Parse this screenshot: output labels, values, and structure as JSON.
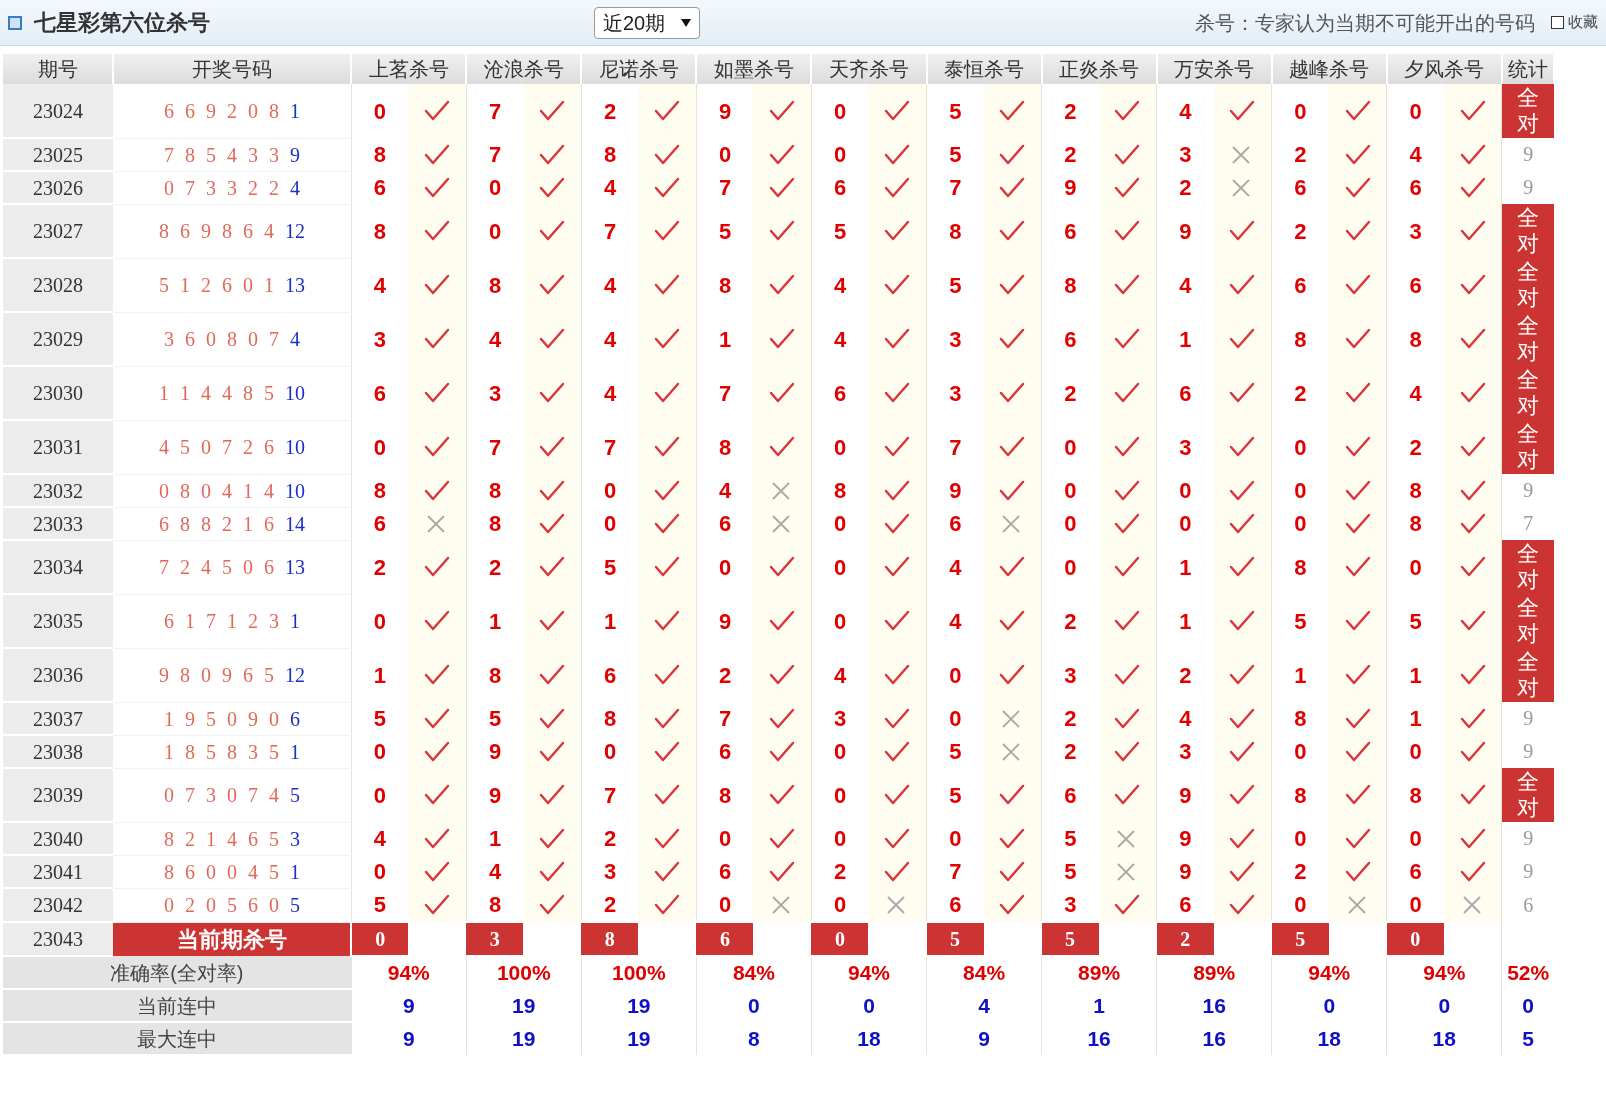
{
  "header": {
    "title": "七星彩第六位杀号",
    "period_select": "近20期",
    "note": "杀号：专家认为当期不可能开出的号码",
    "favorite": {
      "label": "收藏",
      "checked": false
    }
  },
  "table": {
    "columns": [
      "期号",
      "开奖号码",
      "上茗杀号",
      "沧浪杀号",
      "尼诺杀号",
      "如墨杀号",
      "天齐杀号",
      "泰恒杀号",
      "正炎杀号",
      "万安杀号",
      "越峰杀号",
      "夕风杀号",
      "统计"
    ],
    "rows": [
      {
        "period": "23024",
        "numbers": "6 6 9 2 0 8",
        "special": "1",
        "kills": [
          {
            "n": "0",
            "ok": true
          },
          {
            "n": "7",
            "ok": true
          },
          {
            "n": "2",
            "ok": true
          },
          {
            "n": "9",
            "ok": true
          },
          {
            "n": "0",
            "ok": true
          },
          {
            "n": "5",
            "ok": true
          },
          {
            "n": "2",
            "ok": true
          },
          {
            "n": "4",
            "ok": true
          },
          {
            "n": "0",
            "ok": true
          },
          {
            "n": "0",
            "ok": true
          }
        ],
        "stat": "全对",
        "all_correct": true
      },
      {
        "period": "23025",
        "numbers": "7 8 5 4 3 3",
        "special": "9",
        "kills": [
          {
            "n": "8",
            "ok": true
          },
          {
            "n": "7",
            "ok": true
          },
          {
            "n": "8",
            "ok": true
          },
          {
            "n": "0",
            "ok": true
          },
          {
            "n": "0",
            "ok": true
          },
          {
            "n": "5",
            "ok": true
          },
          {
            "n": "2",
            "ok": true
          },
          {
            "n": "3",
            "ok": false
          },
          {
            "n": "2",
            "ok": true
          },
          {
            "n": "4",
            "ok": true
          }
        ],
        "stat": "9",
        "all_correct": false
      },
      {
        "period": "23026",
        "numbers": "0 7 3 3 2 2",
        "special": "4",
        "kills": [
          {
            "n": "6",
            "ok": true
          },
          {
            "n": "0",
            "ok": true
          },
          {
            "n": "4",
            "ok": true
          },
          {
            "n": "7",
            "ok": true
          },
          {
            "n": "6",
            "ok": true
          },
          {
            "n": "7",
            "ok": true
          },
          {
            "n": "9",
            "ok": true
          },
          {
            "n": "2",
            "ok": false
          },
          {
            "n": "6",
            "ok": true
          },
          {
            "n": "6",
            "ok": true
          }
        ],
        "stat": "9",
        "all_correct": false
      },
      {
        "period": "23027",
        "numbers": "8 6 9 8 6 4",
        "special": "12",
        "kills": [
          {
            "n": "8",
            "ok": true
          },
          {
            "n": "0",
            "ok": true
          },
          {
            "n": "7",
            "ok": true
          },
          {
            "n": "5",
            "ok": true
          },
          {
            "n": "5",
            "ok": true
          },
          {
            "n": "8",
            "ok": true
          },
          {
            "n": "6",
            "ok": true
          },
          {
            "n": "9",
            "ok": true
          },
          {
            "n": "2",
            "ok": true
          },
          {
            "n": "3",
            "ok": true
          }
        ],
        "stat": "全对",
        "all_correct": true
      },
      {
        "period": "23028",
        "numbers": "5 1 2 6 0 1",
        "special": "13",
        "kills": [
          {
            "n": "4",
            "ok": true
          },
          {
            "n": "8",
            "ok": true
          },
          {
            "n": "4",
            "ok": true
          },
          {
            "n": "8",
            "ok": true
          },
          {
            "n": "4",
            "ok": true
          },
          {
            "n": "5",
            "ok": true
          },
          {
            "n": "8",
            "ok": true
          },
          {
            "n": "4",
            "ok": true
          },
          {
            "n": "6",
            "ok": true
          },
          {
            "n": "6",
            "ok": true
          }
        ],
        "stat": "全对",
        "all_correct": true
      },
      {
        "period": "23029",
        "numbers": "3 6 0 8 0 7",
        "special": "4",
        "kills": [
          {
            "n": "3",
            "ok": true
          },
          {
            "n": "4",
            "ok": true
          },
          {
            "n": "4",
            "ok": true
          },
          {
            "n": "1",
            "ok": true
          },
          {
            "n": "4",
            "ok": true
          },
          {
            "n": "3",
            "ok": true
          },
          {
            "n": "6",
            "ok": true
          },
          {
            "n": "1",
            "ok": true
          },
          {
            "n": "8",
            "ok": true
          },
          {
            "n": "8",
            "ok": true
          }
        ],
        "stat": "全对",
        "all_correct": true
      },
      {
        "period": "23030",
        "numbers": "1 1 4 4 8 5",
        "special": "10",
        "kills": [
          {
            "n": "6",
            "ok": true
          },
          {
            "n": "3",
            "ok": true
          },
          {
            "n": "4",
            "ok": true
          },
          {
            "n": "7",
            "ok": true
          },
          {
            "n": "6",
            "ok": true
          },
          {
            "n": "3",
            "ok": true
          },
          {
            "n": "2",
            "ok": true
          },
          {
            "n": "6",
            "ok": true
          },
          {
            "n": "2",
            "ok": true
          },
          {
            "n": "4",
            "ok": true
          }
        ],
        "stat": "全对",
        "all_correct": true
      },
      {
        "period": "23031",
        "numbers": "4 5 0 7 2 6",
        "special": "10",
        "kills": [
          {
            "n": "0",
            "ok": true
          },
          {
            "n": "7",
            "ok": true
          },
          {
            "n": "7",
            "ok": true
          },
          {
            "n": "8",
            "ok": true
          },
          {
            "n": "0",
            "ok": true
          },
          {
            "n": "7",
            "ok": true
          },
          {
            "n": "0",
            "ok": true
          },
          {
            "n": "3",
            "ok": true
          },
          {
            "n": "0",
            "ok": true
          },
          {
            "n": "2",
            "ok": true
          }
        ],
        "stat": "全对",
        "all_correct": true
      },
      {
        "period": "23032",
        "numbers": "0 8 0 4 1 4",
        "special": "10",
        "kills": [
          {
            "n": "8",
            "ok": true
          },
          {
            "n": "8",
            "ok": true
          },
          {
            "n": "0",
            "ok": true
          },
          {
            "n": "4",
            "ok": false
          },
          {
            "n": "8",
            "ok": true
          },
          {
            "n": "9",
            "ok": true
          },
          {
            "n": "0",
            "ok": true
          },
          {
            "n": "0",
            "ok": true
          },
          {
            "n": "0",
            "ok": true
          },
          {
            "n": "8",
            "ok": true
          }
        ],
        "stat": "9",
        "all_correct": false
      },
      {
        "period": "23033",
        "numbers": "6 8 8 2 1 6",
        "special": "14",
        "kills": [
          {
            "n": "6",
            "ok": false
          },
          {
            "n": "8",
            "ok": true
          },
          {
            "n": "0",
            "ok": true
          },
          {
            "n": "6",
            "ok": false
          },
          {
            "n": "0",
            "ok": true
          },
          {
            "n": "6",
            "ok": false
          },
          {
            "n": "0",
            "ok": true
          },
          {
            "n": "0",
            "ok": true
          },
          {
            "n": "0",
            "ok": true
          },
          {
            "n": "8",
            "ok": true
          }
        ],
        "stat": "7",
        "all_correct": false
      },
      {
        "period": "23034",
        "numbers": "7 2 4 5 0 6",
        "special": "13",
        "kills": [
          {
            "n": "2",
            "ok": true
          },
          {
            "n": "2",
            "ok": true
          },
          {
            "n": "5",
            "ok": true
          },
          {
            "n": "0",
            "ok": true
          },
          {
            "n": "0",
            "ok": true
          },
          {
            "n": "4",
            "ok": true
          },
          {
            "n": "0",
            "ok": true
          },
          {
            "n": "1",
            "ok": true
          },
          {
            "n": "8",
            "ok": true
          },
          {
            "n": "0",
            "ok": true
          }
        ],
        "stat": "全对",
        "all_correct": true
      },
      {
        "period": "23035",
        "numbers": "6 1 7 1 2 3",
        "special": "1",
        "kills": [
          {
            "n": "0",
            "ok": true
          },
          {
            "n": "1",
            "ok": true
          },
          {
            "n": "1",
            "ok": true
          },
          {
            "n": "9",
            "ok": true
          },
          {
            "n": "0",
            "ok": true
          },
          {
            "n": "4",
            "ok": true
          },
          {
            "n": "2",
            "ok": true
          },
          {
            "n": "1",
            "ok": true
          },
          {
            "n": "5",
            "ok": true
          },
          {
            "n": "5",
            "ok": true
          }
        ],
        "stat": "全对",
        "all_correct": true
      },
      {
        "period": "23036",
        "numbers": "9 8 0 9 6 5",
        "special": "12",
        "kills": [
          {
            "n": "1",
            "ok": true
          },
          {
            "n": "8",
            "ok": true
          },
          {
            "n": "6",
            "ok": true
          },
          {
            "n": "2",
            "ok": true
          },
          {
            "n": "4",
            "ok": true
          },
          {
            "n": "0",
            "ok": true
          },
          {
            "n": "3",
            "ok": true
          },
          {
            "n": "2",
            "ok": true
          },
          {
            "n": "1",
            "ok": true
          },
          {
            "n": "1",
            "ok": true
          }
        ],
        "stat": "全对",
        "all_correct": true
      },
      {
        "period": "23037",
        "numbers": "1 9 5 0 9 0",
        "special": "6",
        "kills": [
          {
            "n": "5",
            "ok": true
          },
          {
            "n": "5",
            "ok": true
          },
          {
            "n": "8",
            "ok": true
          },
          {
            "n": "7",
            "ok": true
          },
          {
            "n": "3",
            "ok": true
          },
          {
            "n": "0",
            "ok": false
          },
          {
            "n": "2",
            "ok": true
          },
          {
            "n": "4",
            "ok": true
          },
          {
            "n": "8",
            "ok": true
          },
          {
            "n": "1",
            "ok": true
          }
        ],
        "stat": "9",
        "all_correct": false
      },
      {
        "period": "23038",
        "numbers": "1 8 5 8 3 5",
        "special": "1",
        "kills": [
          {
            "n": "0",
            "ok": true
          },
          {
            "n": "9",
            "ok": true
          },
          {
            "n": "0",
            "ok": true
          },
          {
            "n": "6",
            "ok": true
          },
          {
            "n": "0",
            "ok": true
          },
          {
            "n": "5",
            "ok": false
          },
          {
            "n": "2",
            "ok": true
          },
          {
            "n": "3",
            "ok": true
          },
          {
            "n": "0",
            "ok": true
          },
          {
            "n": "0",
            "ok": true
          }
        ],
        "stat": "9",
        "all_correct": false
      },
      {
        "period": "23039",
        "numbers": "0 7 3 0 7 4",
        "special": "5",
        "kills": [
          {
            "n": "0",
            "ok": true
          },
          {
            "n": "9",
            "ok": true
          },
          {
            "n": "7",
            "ok": true
          },
          {
            "n": "8",
            "ok": true
          },
          {
            "n": "0",
            "ok": true
          },
          {
            "n": "5",
            "ok": true
          },
          {
            "n": "6",
            "ok": true
          },
          {
            "n": "9",
            "ok": true
          },
          {
            "n": "8",
            "ok": true
          },
          {
            "n": "8",
            "ok": true
          }
        ],
        "stat": "全对",
        "all_correct": true
      },
      {
        "period": "23040",
        "numbers": "8 2 1 4 6 5",
        "special": "3",
        "kills": [
          {
            "n": "4",
            "ok": true
          },
          {
            "n": "1",
            "ok": true
          },
          {
            "n": "2",
            "ok": true
          },
          {
            "n": "0",
            "ok": true
          },
          {
            "n": "0",
            "ok": true
          },
          {
            "n": "0",
            "ok": true
          },
          {
            "n": "5",
            "ok": false
          },
          {
            "n": "9",
            "ok": true
          },
          {
            "n": "0",
            "ok": true
          },
          {
            "n": "0",
            "ok": true
          }
        ],
        "stat": "9",
        "all_correct": false
      },
      {
        "period": "23041",
        "numbers": "8 6 0 0 4 5",
        "special": "1",
        "kills": [
          {
            "n": "0",
            "ok": true
          },
          {
            "n": "4",
            "ok": true
          },
          {
            "n": "3",
            "ok": true
          },
          {
            "n": "6",
            "ok": true
          },
          {
            "n": "2",
            "ok": true
          },
          {
            "n": "7",
            "ok": true
          },
          {
            "n": "5",
            "ok": false
          },
          {
            "n": "9",
            "ok": true
          },
          {
            "n": "2",
            "ok": true
          },
          {
            "n": "6",
            "ok": true
          }
        ],
        "stat": "9",
        "all_correct": false
      },
      {
        "period": "23042",
        "numbers": "0 2 0 5 6 0",
        "special": "5",
        "kills": [
          {
            "n": "5",
            "ok": true
          },
          {
            "n": "8",
            "ok": true
          },
          {
            "n": "2",
            "ok": true
          },
          {
            "n": "0",
            "ok": false
          },
          {
            "n": "0",
            "ok": false
          },
          {
            "n": "6",
            "ok": true
          },
          {
            "n": "3",
            "ok": true
          },
          {
            "n": "6",
            "ok": true
          },
          {
            "n": "0",
            "ok": false
          },
          {
            "n": "0",
            "ok": false
          }
        ],
        "stat": "6",
        "all_correct": false
      }
    ],
    "current": {
      "period": "23043",
      "label": "当前期杀号",
      "kills": [
        "0",
        "3",
        "8",
        "6",
        "0",
        "5",
        "5",
        "2",
        "5",
        "0"
      ]
    },
    "summary": [
      {
        "kind": "rate",
        "label": "准确率(全对率)",
        "values": [
          "94%",
          "100%",
          "100%",
          "84%",
          "94%",
          "84%",
          "89%",
          "89%",
          "94%",
          "94%",
          "52%"
        ]
      },
      {
        "kind": "streak",
        "label": "当前连中",
        "values": [
          "9",
          "19",
          "19",
          "0",
          "0",
          "4",
          "1",
          "16",
          "0",
          "0",
          "0"
        ]
      },
      {
        "kind": "streak",
        "label": "最大连中",
        "values": [
          "9",
          "19",
          "19",
          "8",
          "18",
          "9",
          "16",
          "16",
          "18",
          "18",
          "5"
        ]
      }
    ]
  }
}
